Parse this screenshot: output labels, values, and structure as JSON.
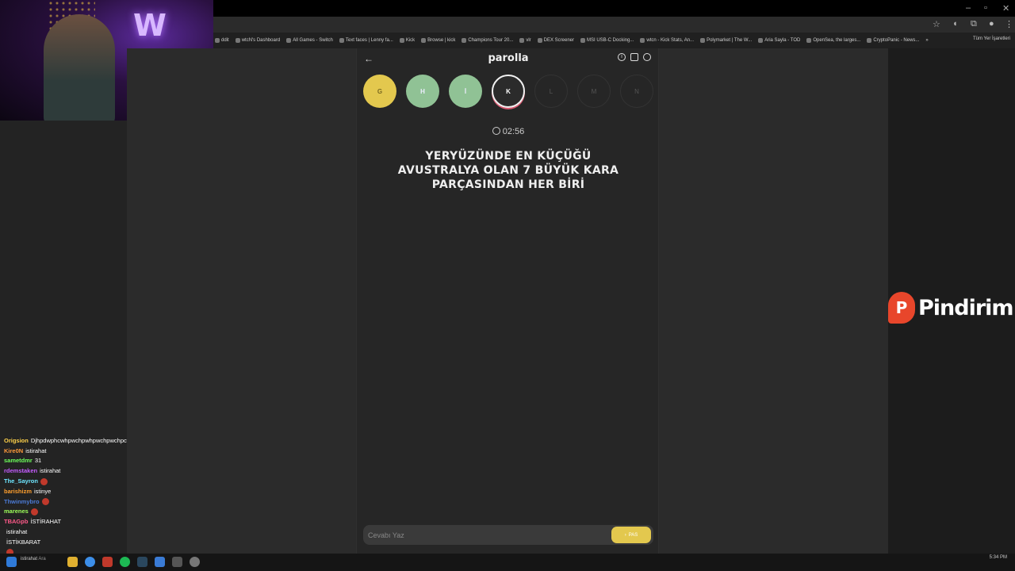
{
  "window": {
    "minimize": "–",
    "maximize": "▫",
    "close": "✕"
  },
  "bookmarks": [
    "ddit",
    "wtcN's Dashboard",
    "All Games - Switch",
    "Text faces | Lenny fa...",
    "Kick",
    "Browse | kick",
    "Champions Tour 20...",
    "vlr",
    "DEX Screener",
    "MSI USB-C Docking...",
    "wtcn - Kick Stats, An...",
    "Polymarket | The W...",
    "Aria Sayla - TOD",
    "OpenSea, the larges...",
    "CryptoPanic - News..."
  ],
  "bookmarks_more": "»",
  "bookmarks_other": "Tüm Yer İşaretleri",
  "app": {
    "title": "parolla",
    "back_icon": "←",
    "info_icon": "i",
    "letters": [
      "G",
      "H",
      "İ",
      "K",
      "L",
      "M",
      "N"
    ],
    "letter_states": [
      "wrong",
      "correct",
      "correct",
      "active",
      "empty",
      "empty",
      "empty"
    ],
    "timer": "02:56",
    "question": "YERYÜZÜNDE EN KÜÇÜĞÜ AVUSTRALYA OLAN 7 BÜYÜK KARA PARÇASINDAN HER BİRİ",
    "answer_placeholder": "Cevabı Yaz",
    "pass_label": "PAS",
    "pass_icon": "›",
    "colors": {
      "yellow": "#e3c84e",
      "green": "#90c295",
      "active_ring": "#d85a72"
    }
  },
  "logo": {
    "mark": "P",
    "text": "Pindirim"
  },
  "chat": [
    {
      "user": "",
      "msg": "",
      "color": "#6ab0ff"
    },
    {
      "user": "Origsion",
      "msg": "Djhpdwphcwhpwchpwhpwchpwchpcwj",
      "color": "#ffd24a"
    },
    {
      "user": "Kire0N",
      "msg": "istirahat",
      "color": "#ff9a3c"
    },
    {
      "user": "sametdmr",
      "msg": "31",
      "color": "#6cff5a"
    },
    {
      "user": "rdemstaken",
      "msg": "istirahat",
      "color": "#c45cff"
    },
    {
      "user": "The_Sayron",
      "msg": "",
      "color": "#6ee6ff",
      "emote": true
    },
    {
      "user": "barishizm",
      "msg": "istinye",
      "color": "#ff9f2e"
    },
    {
      "user": "Thwinmybro",
      "msg": "",
      "color": "#4b7bd6",
      "emote": true
    },
    {
      "user": "marenes",
      "msg": "",
      "color": "#9dff5a",
      "emote": true
    },
    {
      "user": "TBAGpb",
      "msg": "İSTİRAHAT",
      "color": "#ff5a8a"
    },
    {
      "user": "",
      "msg": "istirahat",
      "color": "#cc2244"
    },
    {
      "user": "",
      "msg": "İSTİKBARAT",
      "color": "#cc2244"
    },
    {
      "user": "",
      "msg": "",
      "color": "#cc2244",
      "emote": true
    }
  ],
  "taskbar": {
    "search": "istirahat",
    "search_hint": "Ara",
    "time": "5:34 PM"
  }
}
